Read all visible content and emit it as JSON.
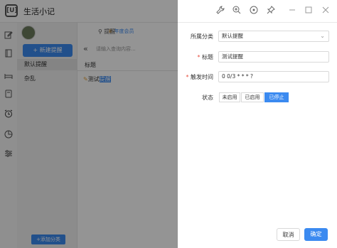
{
  "app": {
    "title": "生活小记",
    "logo_text": "[U]"
  },
  "titlebar_icons": [
    "wrench-icon",
    "zoom-in-icon",
    "target-icon",
    "pin-icon",
    "minimize-icon",
    "maximize-icon",
    "close-icon"
  ],
  "sidebar": {
    "icons": [
      "edit-icon",
      "book-icon",
      "bed-icon",
      "bookmark-icon",
      "alarm-icon",
      "chart-icon",
      "settings-icon"
    ]
  },
  "leftpanel": {
    "new_button": "+ 新建提醒",
    "categories": [
      {
        "label": "默认提醒",
        "selected": true
      },
      {
        "label": "杂乱",
        "selected": false
      }
    ],
    "add_category": "+添加分类"
  },
  "main": {
    "badge": "年度会员",
    "tab": "提醒",
    "search_placeholder": "请输入查询内容...",
    "column_header": "标题",
    "rows": [
      {
        "prefix": "测试",
        "highlight": "提醒"
      }
    ]
  },
  "drawer": {
    "category_label": "所属分类",
    "category_value": "默认提醒",
    "title_label": "标题",
    "title_value": "测试提醒",
    "trigger_label": "触发时间",
    "trigger_value": "0 0/3 * * * ?",
    "status_label": "状态",
    "status_options": [
      "未启用",
      "已启用",
      "已停止"
    ],
    "status_selected": "已停止",
    "cancel": "取消",
    "confirm": "确定"
  },
  "colors": {
    "accent": "#3b8af0",
    "required": "#e74c3c"
  }
}
